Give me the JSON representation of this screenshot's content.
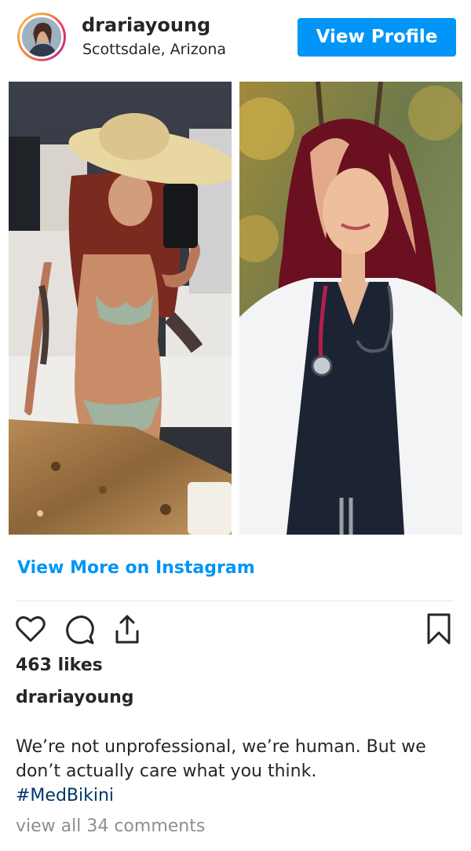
{
  "header": {
    "username": "drariayoung",
    "location": "Scottsdale, Arizona",
    "view_profile_label": "View Profile"
  },
  "post": {
    "view_more_label": "View More on Instagram",
    "likes": "463 likes",
    "caption_username": "drariayoung",
    "caption_text": "We’re not unprofessional, we’re human. But we don’t actually care what you think.",
    "hashtag": "#MedBikini",
    "comments_link": "view all 34 comments"
  },
  "icons": {
    "like": "heart-icon",
    "comment": "comment-bubble-icon",
    "share": "share-upload-icon",
    "save": "bookmark-icon"
  },
  "colors": {
    "accent": "#0095f6",
    "text": "#262626",
    "muted": "#8e8e8e",
    "hashtag": "#00376b"
  }
}
